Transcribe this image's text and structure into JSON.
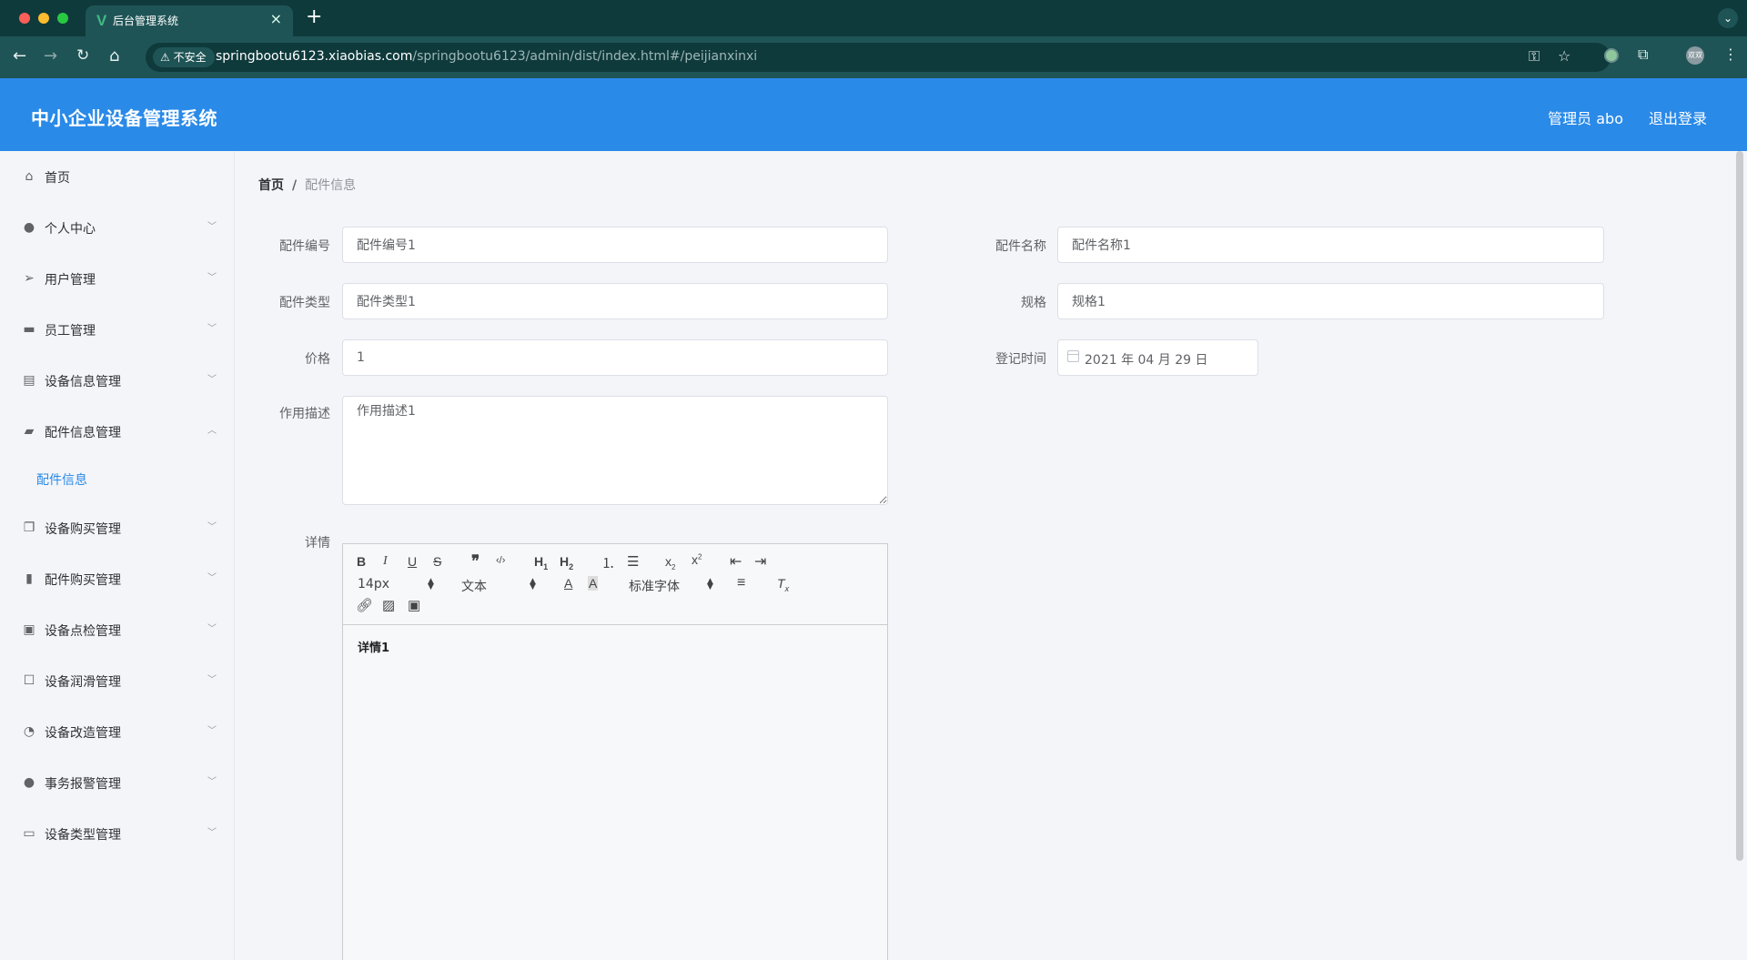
{
  "browser": {
    "tab_title": "后台管理系统",
    "tab_favicon": "V",
    "insecure_label": "不安全",
    "url_host": "springbootu6123.xiaobias.com",
    "url_path": "/springbootu6123/admin/dist/index.html#/peijianxinxi",
    "icons": [
      "back-icon",
      "forward-icon",
      "reload-icon",
      "home-icon",
      "key-icon",
      "star-icon",
      "extensions-icon",
      "profile-avatar-icon",
      "menu-icon"
    ],
    "profile_text": "双双"
  },
  "header": {
    "title": "中小企业设备管理系统",
    "user_label": "管理员 abo",
    "logout_label": "退出登录",
    "bg_color": "#2a8ae8"
  },
  "sidebar": {
    "items": [
      {
        "label": "首页",
        "icon": "home-icon"
      },
      {
        "label": "个人中心",
        "icon": "user-icon"
      },
      {
        "label": "用户管理",
        "icon": "send-icon"
      },
      {
        "label": "员工管理",
        "icon": "monitor-icon"
      },
      {
        "label": "设备信息管理",
        "icon": "clipboard-icon"
      },
      {
        "label": "配件信息管理",
        "icon": "wallet-icon",
        "expanded": true
      },
      {
        "label": "设备购买管理",
        "icon": "copy-icon"
      },
      {
        "label": "配件购买管理",
        "icon": "bar-chart-icon"
      },
      {
        "label": "设备点检管理",
        "icon": "checklist-icon"
      },
      {
        "label": "设备润滑管理",
        "icon": "chat-icon"
      },
      {
        "label": "设备改造管理",
        "icon": "gauge-icon"
      },
      {
        "label": "事务报警管理",
        "icon": "user-alert-icon"
      },
      {
        "label": "设备类型管理",
        "icon": "card-icon"
      }
    ],
    "sub_item": "配件信息"
  },
  "breadcrumb": {
    "home": "首页",
    "separator": "/",
    "current": "配件信息"
  },
  "form": {
    "code_label": "配件编号",
    "code_value": "配件编号1",
    "name_label": "配件名称",
    "name_value": "配件名称1",
    "type_label": "配件类型",
    "type_value": "配件类型1",
    "spec_label": "规格",
    "spec_value": "规格1",
    "price_label": "价格",
    "price_value": "1",
    "date_label": "登记时间",
    "date_value": "2021 年 04 月 29 日",
    "desc_label": "作用描述",
    "desc_value": "作用描述1",
    "detail_label": "详情"
  },
  "editor": {
    "size_select": "14px",
    "header_select": "文本",
    "font_select": "标准字体",
    "content": "详情1"
  }
}
